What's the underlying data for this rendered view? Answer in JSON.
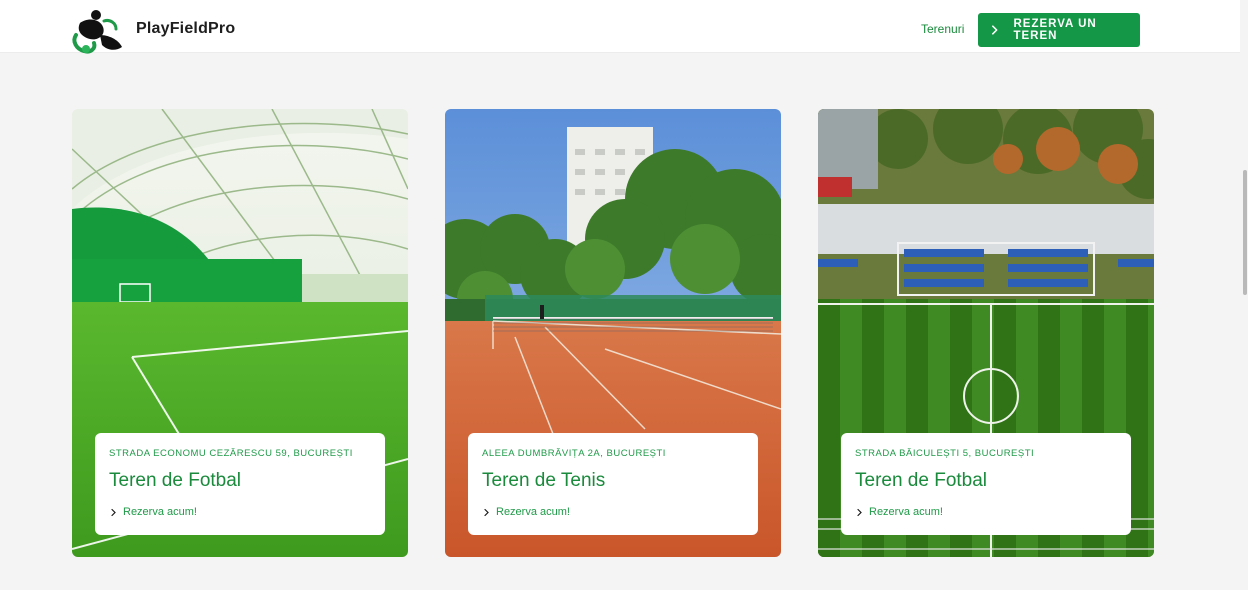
{
  "header": {
    "brand": "PlayFieldPro",
    "nav_link": "Terenuri",
    "cta_label": "REZERVA UN TEREN"
  },
  "cards": [
    {
      "address": "Strada Economu Cezărescu 59, București",
      "title": "Teren de Fotbal",
      "action": "Rezerva acum!"
    },
    {
      "address": "Aleea Dumbrăvița 2A, București",
      "title": "Teren de Tenis",
      "action": "Rezerva acum!"
    },
    {
      "address": "Strada Băiculești 5, București",
      "title": "Teren de Fotbal",
      "action": "Rezerva acum!"
    }
  ],
  "colors": {
    "accent": "#149746",
    "text_green": "#1a8a3c",
    "background": "#f4f4f4"
  }
}
